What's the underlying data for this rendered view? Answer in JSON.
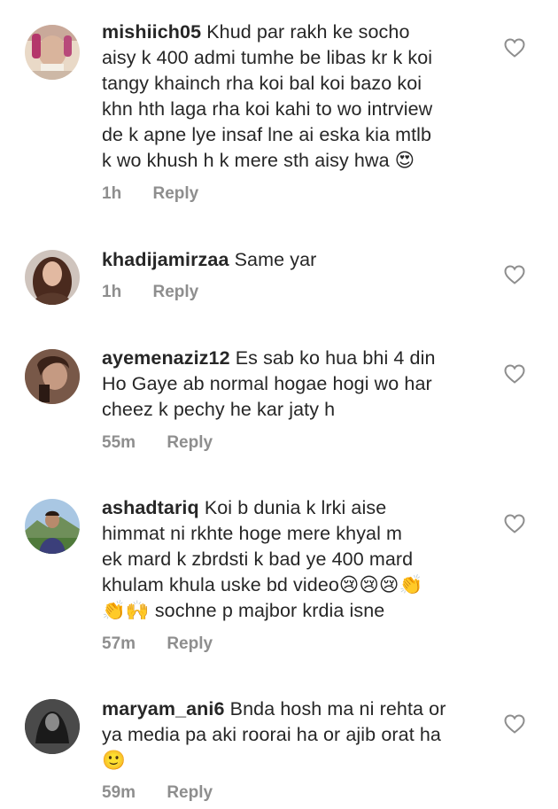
{
  "comments": [
    {
      "username": "mishiich05",
      "lines": [
        "Khud par rakh ke socho",
        "aisy k 400 admi tumhe be libas kr k koi",
        "tangy khainch rha koi bal koi bazo koi",
        "khn hth laga rha koi kahi to wo intrview",
        "de k apne lye insaf lne ai eska kia mtlb",
        "k wo khush h k mere sth aisy hwa 😍"
      ],
      "time": "1h",
      "reply": "Reply"
    },
    {
      "username": "khadijamirzaa",
      "lines": [
        "Same yar"
      ],
      "time": "1h",
      "reply": "Reply"
    },
    {
      "username": "ayemenaziz12",
      "lines": [
        "Es sab ko hua bhi 4 din",
        "Ho Gaye ab normal hogae hogi wo har",
        "cheez k pechy he kar jaty h"
      ],
      "time": "55m",
      "reply": "Reply"
    },
    {
      "username": "ashadtariq",
      "lines": [
        "Koi b dunia k lrki aise",
        "himmat ni rkhte hoge mere khyal m",
        "ek mard k zbrdsti k bad ye 400 mard",
        "khulam khula uske bd video😢😢😢👏",
        "👏🙌 sochne p majbor krdia isne"
      ],
      "time": "57m",
      "reply": "Reply"
    },
    {
      "username": "maryam_ani6",
      "lines": [
        "Bnda hosh ma ni rehta or",
        "ya media pa aki roorai ha or ajib orat ha",
        "🙂"
      ],
      "time": "59m",
      "reply": "Reply"
    }
  ],
  "colors": {
    "text": "#262626",
    "meta": "#8e8e8e",
    "heart_outline": "#8e8e8e"
  },
  "icons": {
    "like": "heart-outline-icon",
    "avatar": "profile-avatar"
  }
}
